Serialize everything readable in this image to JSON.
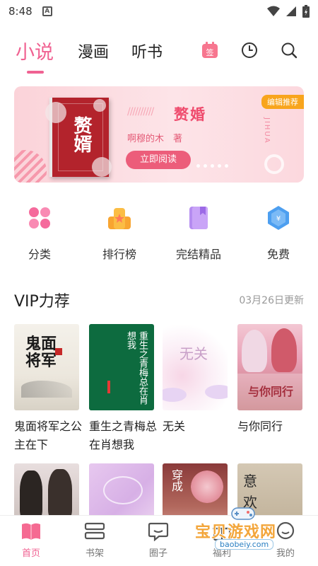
{
  "status_bar": {
    "time": "8:48",
    "notification_icon": "A"
  },
  "top_nav": {
    "tabs": [
      {
        "label": "小说",
        "active": true
      },
      {
        "label": "漫画",
        "active": false
      },
      {
        "label": "听书",
        "active": false
      }
    ],
    "icons": [
      "sign-in-icon",
      "history-clock-icon",
      "search-icon"
    ],
    "sign_in_label": "签",
    "accent_color": "#f06292"
  },
  "banner": {
    "badge": "编辑推荐",
    "book_title": "赘婚",
    "cover_title": "赘婿",
    "author_line": "啊穆的木　著",
    "read_button": "立即阅读",
    "side_text": "JIHUA",
    "slashes": "//////////"
  },
  "categories": [
    {
      "label": "分类",
      "icon": "grid-icon"
    },
    {
      "label": "排行榜",
      "icon": "podium-icon"
    },
    {
      "label": "完结精品",
      "icon": "bookmark-book-icon"
    },
    {
      "label": "免费",
      "icon": "free-coin-icon"
    }
  ],
  "vip": {
    "title": "VIP力荐",
    "updated": "03月26日更新",
    "books": [
      {
        "title": "鬼面将军之公主在下",
        "cover_text": "鬼面将军"
      },
      {
        "title": "重生之青梅总在肖想我",
        "cover_text": "重生之青梅总在肖想我"
      },
      {
        "title": "无关",
        "cover_text": "无关"
      },
      {
        "title": "与你同行",
        "cover_text": "与你同行"
      }
    ],
    "second_row_cover_texts": [
      "",
      "",
      "穿成",
      "意欢"
    ]
  },
  "bottom_nav": [
    {
      "label": "首页",
      "icon": "home-book-icon",
      "active": true
    },
    {
      "label": "书架",
      "icon": "bookshelf-icon",
      "active": false
    },
    {
      "label": "圈子",
      "icon": "chat-bubble-icon",
      "active": false
    },
    {
      "label": "福利",
      "icon": "gift-icon",
      "active": false
    },
    {
      "label": "我的",
      "icon": "profile-icon",
      "active": false
    }
  ],
  "watermark": {
    "text": "宝贝游戏网",
    "url": "baobeiy.com"
  }
}
